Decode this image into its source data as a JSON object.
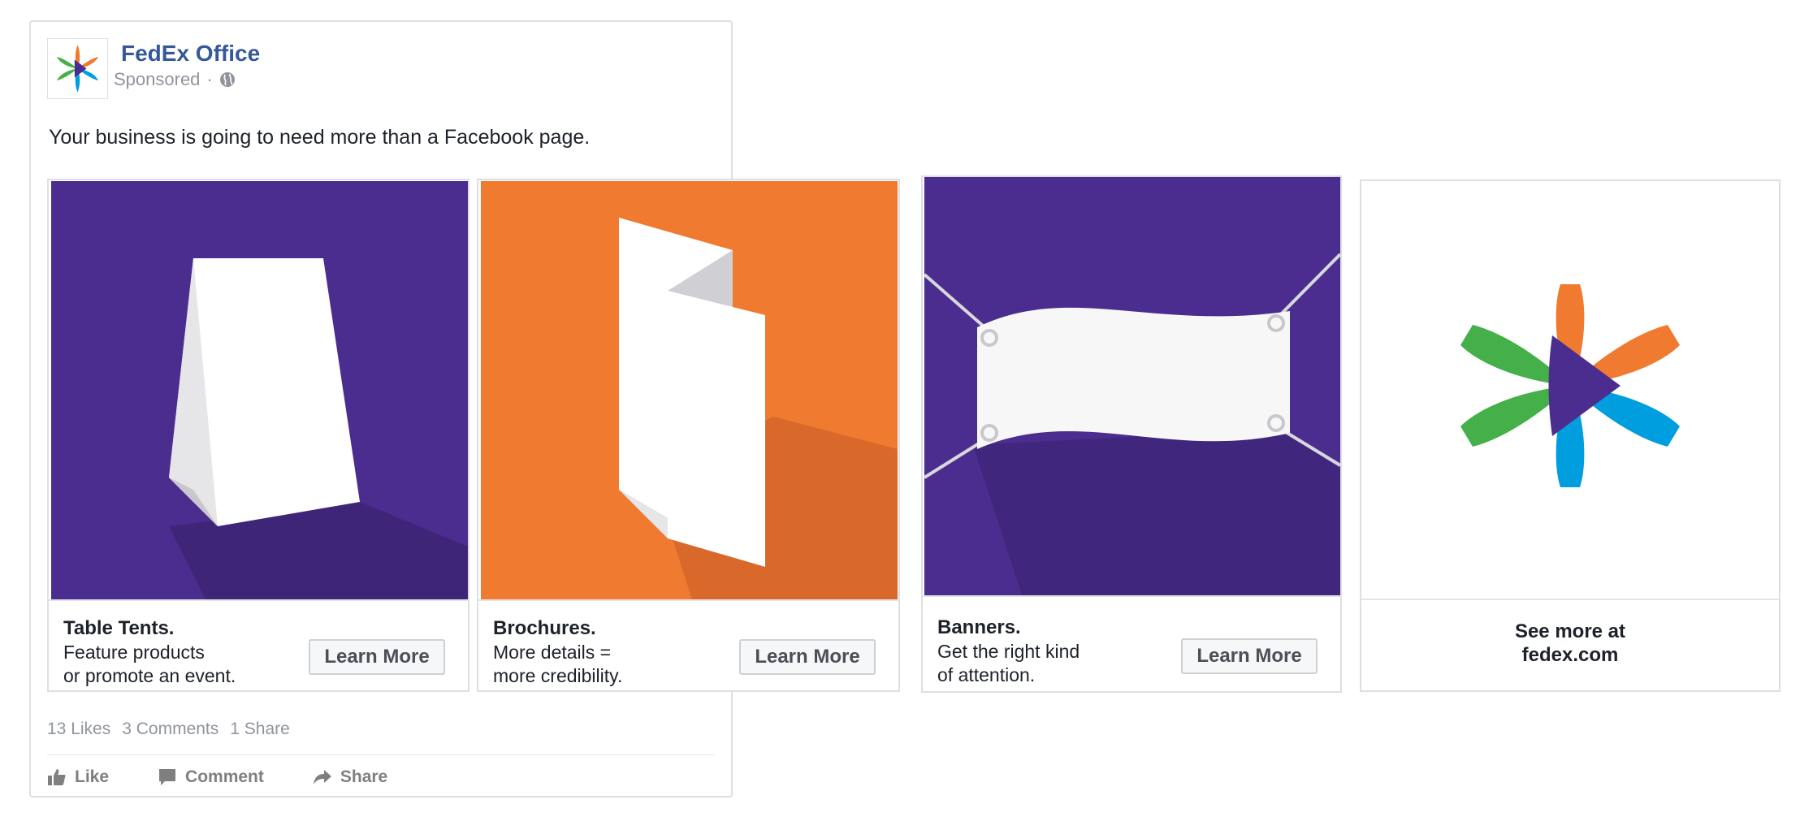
{
  "page": {
    "name": "FedEx Office",
    "sponsored": "Sponsored",
    "separator": "·",
    "post_text": "Your business is going to need more than a Facebook page."
  },
  "cards": [
    {
      "title": "Table Tents.",
      "desc_line1": "Feature products",
      "desc_line2": "or promote an event.",
      "cta": "Learn More",
      "bg": "#4b2d8f"
    },
    {
      "title": "Brochures.",
      "desc_line1": "More details =",
      "desc_line2": "more credibility.",
      "cta": "Learn More",
      "bg": "#ef7a30"
    },
    {
      "title": "Banners.",
      "desc_line1": "Get the right kind",
      "desc_line2": "of attention.",
      "cta": "Learn More",
      "bg": "#4b2d8f"
    },
    {
      "see_more_line1": "See more at",
      "see_more_line2": "fedex.com"
    }
  ],
  "stats": {
    "likes": "13 Likes",
    "comments": "3 Comments",
    "shares": "1 Share"
  },
  "actions": {
    "like": "Like",
    "comment": "Comment",
    "share": "Share"
  },
  "colors": {
    "link_blue": "#365899",
    "fedex_purple": "#4b2d8f",
    "fedex_orange": "#ef7a30",
    "logo_green": "#45b049",
    "logo_blue": "#009ddf"
  },
  "icons": {
    "globe": "globe-icon",
    "like": "thumbs-up-icon",
    "comment": "comment-icon",
    "share": "share-arrow-icon"
  }
}
